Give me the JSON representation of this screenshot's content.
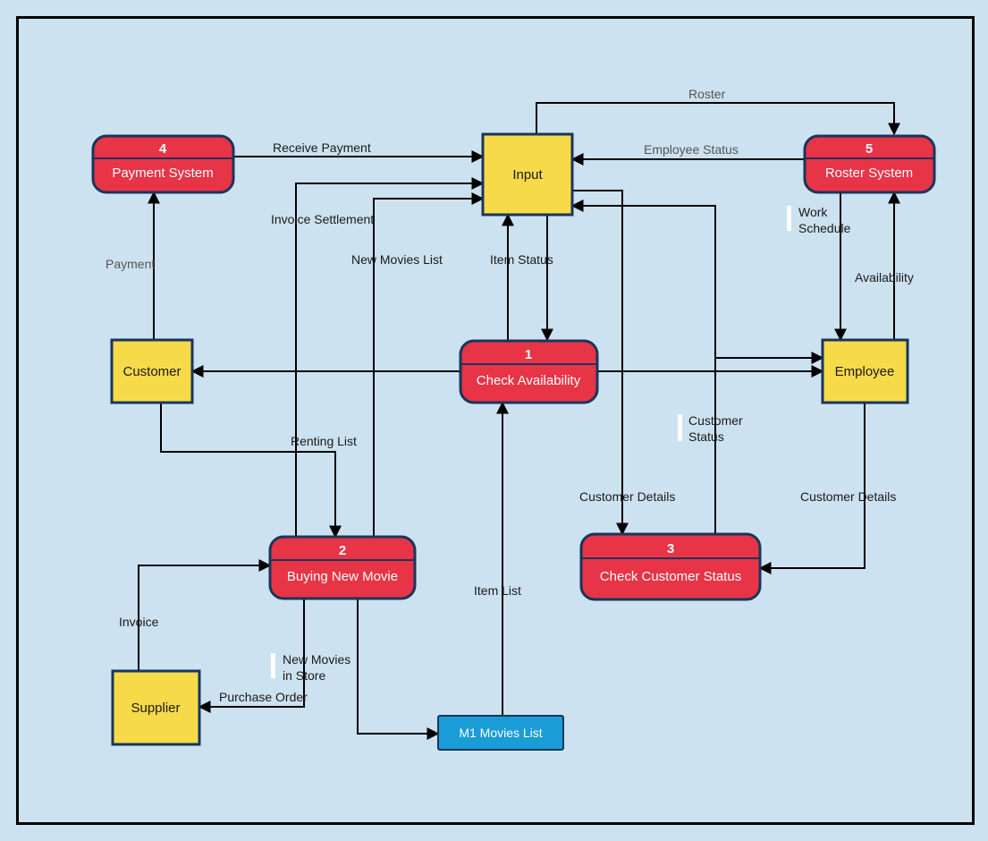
{
  "nodes": {
    "process1": {
      "num": "1",
      "label": "Check Availability"
    },
    "process2": {
      "num": "2",
      "label": "Buying New Movie"
    },
    "process3": {
      "num": "3",
      "label": "Check Customer Status"
    },
    "process4": {
      "num": "4",
      "label": "Payment System"
    },
    "process5": {
      "num": "5",
      "label": "Roster System"
    },
    "entityInput": {
      "label": "Input"
    },
    "entityCustomer": {
      "label": "Customer"
    },
    "entitySupplier": {
      "label": "Supplier"
    },
    "entityEmployee": {
      "label": "Employee"
    },
    "storeMovies": {
      "label": "M1 Movies List"
    }
  },
  "flows": {
    "roster": "Roster",
    "employeeStatus": "Employee Status",
    "receivePayment": "Receive Payment",
    "invoiceSettlement": "Invoice Settlement",
    "newMoviesList": "New Movies List",
    "itemStatus": "Item Status",
    "workSchedule1": "Work",
    "workSchedule2": "Schedule",
    "availability": "Availability",
    "customerStatus1": "Customer",
    "customerStatus2": "Status",
    "customerDetails": "Customer Details",
    "customerDetails2": "Customer Details",
    "rentingList": "Renting List",
    "itemList": "Item List",
    "newMoviesInStore1": "New Movies",
    "newMoviesInStore2": "in Store",
    "purchaseOrder": "Purchase Order",
    "invoice": "Invoice",
    "payment": "Payment"
  }
}
